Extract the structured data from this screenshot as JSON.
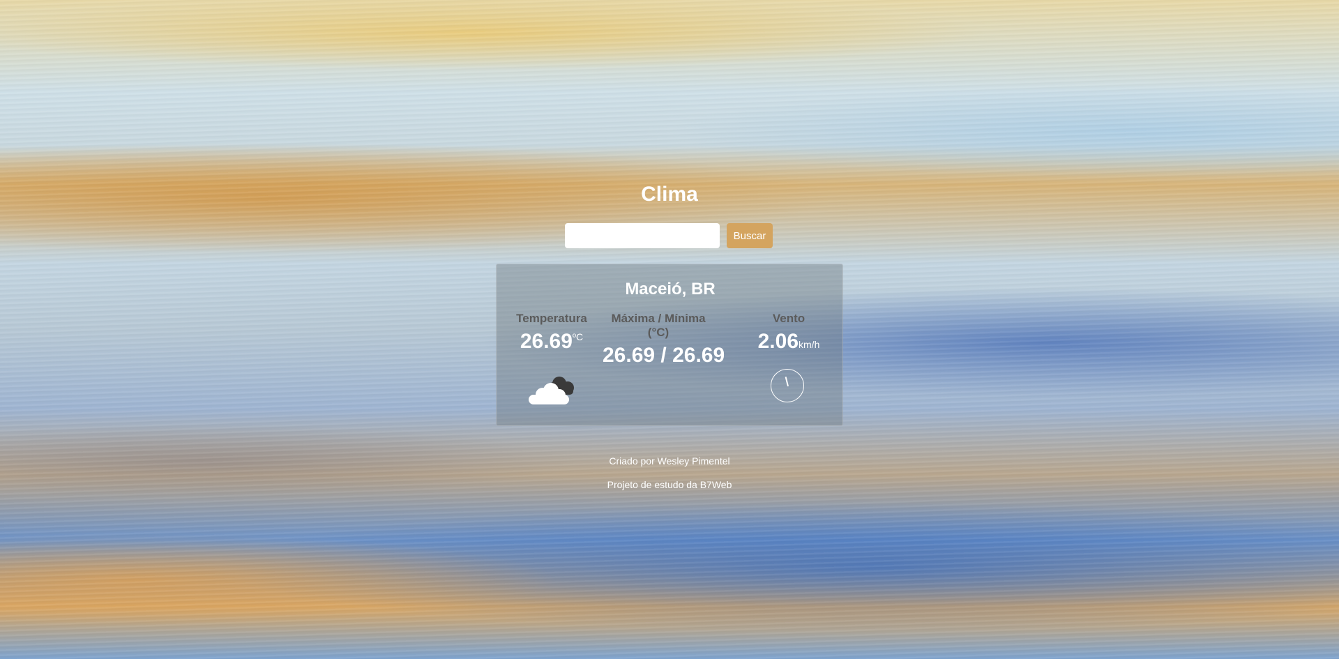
{
  "page": {
    "title": "Clima"
  },
  "search": {
    "input_value": "",
    "input_placeholder": "",
    "button_label": "Buscar"
  },
  "result": {
    "city": "Maceió, BR",
    "temperature": {
      "label": "Temperatura",
      "value": "26.69",
      "unit": "ºC"
    },
    "min_max": {
      "label": "Máxima / Mínima (°C)",
      "value": "26.69 / 26.69"
    },
    "wind": {
      "label": "Vento",
      "value": "2.06",
      "unit": "km/h",
      "direction_deg": 346
    },
    "weather_icon": "cloud-icon"
  },
  "footer": {
    "line1": "Criado por Wesley Pimentel",
    "line2": "Projeto de estudo da B7Web"
  },
  "colors": {
    "accent_button": "#d4a45f",
    "label_text": "#5b5b5b",
    "value_text": "#ffffff"
  }
}
